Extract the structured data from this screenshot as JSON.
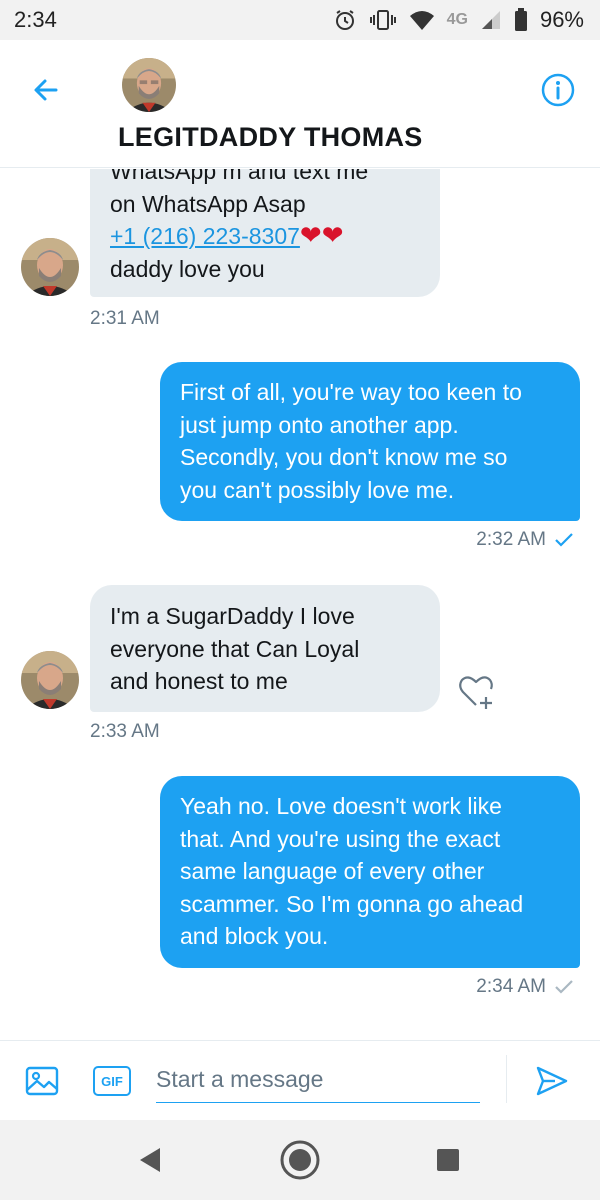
{
  "status_bar": {
    "time": "2:34",
    "network": "4G",
    "battery": "96%"
  },
  "header": {
    "contact_name": "LEGITDADDY THOMAS",
    "back_icon": "arrow-left-icon",
    "info_icon": "info-icon"
  },
  "colors": {
    "accent": "#1da1f2",
    "incoming_bubble": "#e6ecf0",
    "timestamp": "#657786",
    "heart": "#d9132b"
  },
  "messages": [
    {
      "direction": "incoming",
      "lines": [
        "WhatsApp m and text me",
        "on WhatsApp Asap"
      ],
      "phone": "+1 (216) 223-8307",
      "emoji": "❤❤",
      "last_line": "daddy love you",
      "time": "2:31 AM"
    },
    {
      "direction": "outgoing",
      "lines": [
        "First of all, you're way too keen to",
        "just jump onto another app.",
        "Secondly, you don't know me so",
        "you can't possibly love me."
      ],
      "time": "2:32 AM",
      "status": "read"
    },
    {
      "direction": "incoming",
      "lines": [
        "I'm a SugarDaddy I love",
        "everyone that Can Loyal",
        "and honest to me"
      ],
      "time": "2:33 AM"
    },
    {
      "direction": "outgoing",
      "lines": [
        "Yeah no. Love doesn't work like",
        "that. And you're using the exact",
        "same language of every other",
        "scammer. So I'm gonna go ahead",
        "and block you."
      ],
      "time": "2:34 AM",
      "status": "sent"
    }
  ],
  "composer": {
    "placeholder": "Start a message",
    "gif_label": "GIF"
  }
}
